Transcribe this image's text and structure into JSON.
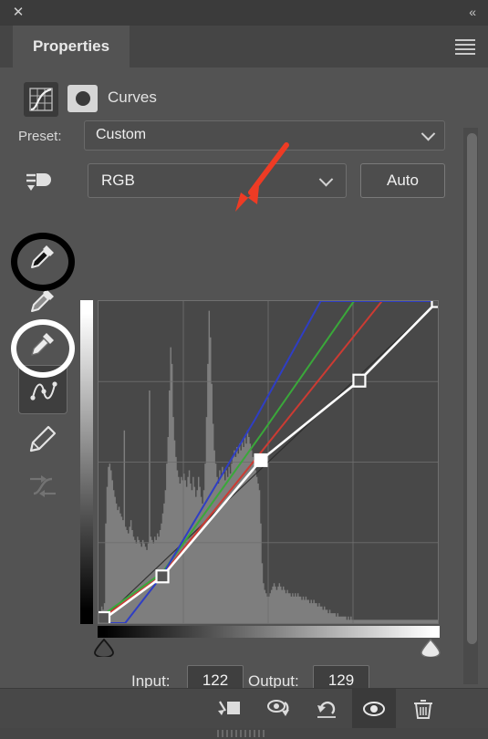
{
  "window": {
    "close_label": "✕",
    "collapse_label": "«",
    "menu_icon": "hamburger-menu-icon"
  },
  "tabs": [
    {
      "label": "Properties",
      "active": true
    }
  ],
  "adjustment": {
    "title": "Curves",
    "layer_icon": "curves-adjustment-icon",
    "mask_icon": "layer-mask-thumbnail"
  },
  "preset": {
    "label": "Preset:",
    "value": "Custom",
    "chevron": "chevron-down-icon"
  },
  "channel": {
    "value": "RGB",
    "chevron": "chevron-down-icon",
    "preset_icon": "curves-preset-options-icon"
  },
  "auto": {
    "label": "Auto"
  },
  "tools": [
    {
      "name": "sample-black-point-eyedropper",
      "selected": false,
      "disabled": false,
      "annotation": "black-circle"
    },
    {
      "name": "sample-gray-point-eyedropper",
      "selected": false,
      "disabled": false,
      "annotation": ""
    },
    {
      "name": "sample-white-point-eyedropper",
      "selected": false,
      "disabled": false,
      "annotation": "white-circle"
    },
    {
      "name": "edit-points-curve-tool",
      "selected": true,
      "disabled": false,
      "annotation": ""
    },
    {
      "name": "draw-pencil-curve-tool",
      "selected": false,
      "disabled": false,
      "annotation": ""
    },
    {
      "name": "smooth-curve-tool",
      "selected": false,
      "disabled": true,
      "annotation": ""
    }
  ],
  "io": {
    "input_label": "Input:",
    "input_value": "122",
    "output_label": "Output:",
    "output_value": "129"
  },
  "bottom_bar": [
    {
      "name": "clip-to-layer-button",
      "active": false
    },
    {
      "name": "view-previous-state-button",
      "active": false
    },
    {
      "name": "reset-adjustment-button",
      "active": false
    },
    {
      "name": "toggle-layer-visibility-button",
      "active": true
    },
    {
      "name": "delete-adjustment-layer-button",
      "active": false
    }
  ],
  "annotation": {
    "arrow_color": "#ee3b24",
    "arrow_target": "channel-select"
  },
  "colors": {
    "panel_bg": "#535353",
    "titlebar_bg": "#3b3b3b",
    "tabstrip_bg": "#454545",
    "field_bg": "#4d4d4d",
    "plot_bg": "#484848",
    "curve_rgb": "#ffffff",
    "curve_red": "#cc3b33",
    "curve_green": "#3aa83a",
    "curve_blue": "#2f3ec4",
    "histogram": "#a0a0a0"
  },
  "chart_data": {
    "type": "line",
    "title": "Curves",
    "xlabel": "Input",
    "ylabel": "Output",
    "xlim": [
      0,
      255
    ],
    "ylim": [
      0,
      255
    ],
    "grid": true,
    "grid_divisions": 4,
    "selected_point": {
      "input": 122,
      "output": 129
    },
    "series": [
      {
        "name": "RGB",
        "color": "#ffffff",
        "points": [
          {
            "input": 0,
            "output": 0
          },
          {
            "input": 48,
            "output": 37
          },
          {
            "input": 122,
            "output": 129
          },
          {
            "input": 196,
            "output": 192
          },
          {
            "input": 255,
            "output": 255
          }
        ]
      },
      {
        "name": "Red",
        "color": "#cc3b33",
        "points": [
          {
            "input": 0,
            "output": 2
          },
          {
            "input": 48,
            "output": 38
          },
          {
            "input": 128,
            "output": 143
          },
          {
            "input": 213,
            "output": 255
          },
          {
            "input": 255,
            "output": 255
          }
        ]
      },
      {
        "name": "Green",
        "color": "#3aa83a",
        "points": [
          {
            "input": 0,
            "output": 4
          },
          {
            "input": 48,
            "output": 40
          },
          {
            "input": 124,
            "output": 152
          },
          {
            "input": 192,
            "output": 255
          },
          {
            "input": 255,
            "output": 255
          }
        ]
      },
      {
        "name": "Blue",
        "color": "#2f3ec4",
        "points": [
          {
            "input": 0,
            "output": 0
          },
          {
            "input": 20,
            "output": 0
          },
          {
            "input": 48,
            "output": 38
          },
          {
            "input": 118,
            "output": 162
          },
          {
            "input": 167,
            "output": 255
          },
          {
            "input": 255,
            "output": 255
          }
        ]
      }
    ],
    "histogram": {
      "color": "#a0a0a0",
      "bins": [
        2,
        3,
        5,
        4,
        6,
        30,
        41,
        47,
        48,
        46,
        43,
        40,
        38,
        36,
        34,
        35,
        33,
        32,
        31,
        58,
        29,
        28,
        27,
        29,
        31,
        28,
        26,
        25,
        24,
        26,
        25,
        24,
        23,
        25,
        24,
        23,
        22,
        24,
        70,
        26,
        25,
        24,
        26,
        25,
        27,
        26,
        28,
        30,
        33,
        36,
        40,
        48,
        56,
        70,
        83,
        78,
        62,
        55,
        50,
        46,
        44,
        42,
        44,
        43,
        45,
        43,
        41,
        44,
        46,
        42,
        40,
        44,
        41,
        38,
        40,
        44,
        41,
        38,
        36,
        40,
        48,
        62,
        78,
        94,
        86,
        72,
        60,
        52,
        48,
        44,
        42,
        46,
        44,
        47,
        45,
        43,
        46,
        44,
        47,
        45,
        48,
        50,
        52,
        50,
        53,
        51,
        54,
        52,
        55,
        53,
        56,
        54,
        58,
        56,
        54,
        52,
        50,
        48,
        46,
        44,
        42,
        40,
        30,
        18,
        12,
        10,
        9,
        8,
        8,
        9,
        10,
        11,
        12,
        11,
        10,
        11,
        12,
        11,
        10,
        11,
        10,
        9,
        10,
        9,
        9,
        8,
        9,
        8,
        9,
        8,
        9,
        8,
        8,
        7,
        8,
        7,
        8,
        7,
        7,
        6,
        7,
        6,
        7,
        6,
        6,
        5,
        6,
        5,
        5,
        4,
        5,
        4,
        4,
        3,
        4,
        3,
        3,
        3,
        3,
        2,
        3,
        2,
        2,
        2,
        2,
        2,
        2,
        1,
        2,
        1,
        2,
        1,
        1,
        1,
        1,
        1,
        1,
        1,
        1,
        1,
        1,
        1,
        1,
        1,
        1,
        1,
        1,
        1,
        1,
        1,
        1,
        1,
        1,
        1,
        1,
        1,
        1,
        1,
        1,
        1,
        1,
        1,
        1,
        1,
        1,
        1,
        1,
        1,
        1,
        1,
        1,
        1,
        1,
        1,
        1,
        1,
        1,
        1,
        1,
        1,
        1,
        1,
        1,
        1,
        1,
        1,
        1,
        1,
        1,
        1,
        1,
        1,
        1,
        1,
        1,
        1
      ]
    },
    "black_point_slider": 0,
    "white_point_slider": 255
  }
}
